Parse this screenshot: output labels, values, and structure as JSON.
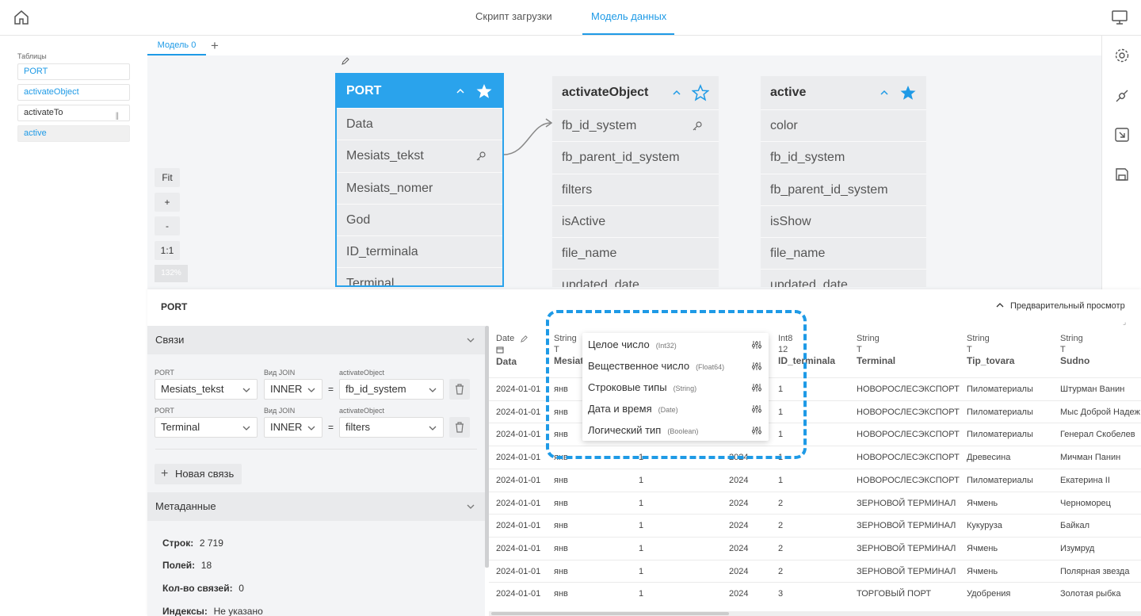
{
  "top_tabs": [
    "Скрипт загрузки",
    "Модель данных"
  ],
  "sidebar": {
    "title": "Таблицы",
    "items": [
      "PORT",
      "activateObject",
      "activateTo",
      "active"
    ]
  },
  "model_tab": "Модель 0",
  "zoom": {
    "fit": "Fit",
    "plus": "+",
    "minus": "-",
    "one": "1:1",
    "pct": "132%"
  },
  "tables": {
    "port": {
      "name": "PORT",
      "fields": [
        "Data",
        "Mesiats_tekst",
        "Mesiats_nomer",
        "God",
        "ID_terminala",
        "Terminal"
      ]
    },
    "activate_object": {
      "name": "activateObject",
      "fields": [
        "fb_id_system",
        "fb_parent_id_system",
        "filters",
        "isActive",
        "file_name",
        "updated_date"
      ]
    },
    "active": {
      "name": "active",
      "fields": [
        "color",
        "fb_id_system",
        "fb_parent_id_system",
        "isShow",
        "file_name",
        "updated_date"
      ]
    }
  },
  "panel": {
    "title": "PORT",
    "preview": "Предварительный просмотр"
  },
  "links": {
    "header": "Связи",
    "rows": [
      {
        "left_label": "PORT",
        "left_value": "Mesiats_tekst",
        "join_label": "Вид JOIN",
        "join_value": "INNER",
        "eq": "=",
        "right_label": "activateObject",
        "right_value": "fb_id_system"
      },
      {
        "left_label": "PORT",
        "left_value": "Terminal",
        "join_label": "Вид JOIN",
        "join_value": "INNER",
        "eq": "=",
        "right_label": "activateObject",
        "right_value": "filters"
      }
    ],
    "new_link": "Новая связь"
  },
  "metadata": {
    "header": "Метаданные",
    "rows": [
      {
        "key": "Строк:",
        "value": "2 719"
      },
      {
        "key": "Полей:",
        "value": "18"
      },
      {
        "key": "Кол-во связей:",
        "value": "0"
      },
      {
        "key": "Индексы:",
        "value": "Не указано"
      }
    ]
  },
  "grid": {
    "columns": [
      {
        "type": "Date",
        "icon": "calendar-icon",
        "name": "Data"
      },
      {
        "type": "String",
        "icon": "T",
        "name": "Mesiats_tekst"
      },
      {
        "type": "",
        "icon": "",
        "name": ""
      },
      {
        "type": "",
        "icon": "",
        "name": ""
      },
      {
        "type": "Int8",
        "icon": "12",
        "name": "ID_terminala"
      },
      {
        "type": "String",
        "icon": "T",
        "name": "Terminal"
      },
      {
        "type": "String",
        "icon": "T",
        "name": "Tip_tovara"
      },
      {
        "type": "String",
        "icon": "T",
        "name": "Sudno"
      }
    ],
    "rows": [
      [
        "2024-01-01",
        "янв",
        "",
        "",
        "1",
        "НОВОРОСЛЕСЭКСПОРТ",
        "Пиломатериалы",
        "Штурман Ванин"
      ],
      [
        "2024-01-01",
        "янв",
        "",
        "",
        "1",
        "НОВОРОСЛЕСЭКСПОРТ",
        "Пиломатериалы",
        "Мыс Доброй Надеж"
      ],
      [
        "2024-01-01",
        "янв",
        "",
        "",
        "1",
        "НОВОРОСЛЕСЭКСПОРТ",
        "Пиломатериалы",
        "Генерал Скобелев"
      ],
      [
        "2024-01-01",
        "янв",
        "1",
        "2024",
        "1",
        "НОВОРОСЛЕСЭКСПОРТ",
        "Древесина",
        "Мичман Панин"
      ],
      [
        "2024-01-01",
        "янв",
        "1",
        "2024",
        "1",
        "НОВОРОСЛЕСЭКСПОРТ",
        "Пиломатериалы",
        "Екатерина II"
      ],
      [
        "2024-01-01",
        "янв",
        "1",
        "2024",
        "2",
        "ЗЕРНОВОЙ ТЕРМИНАЛ",
        "Ячмень",
        "Черноморец"
      ],
      [
        "2024-01-01",
        "янв",
        "1",
        "2024",
        "2",
        "ЗЕРНОВОЙ ТЕРМИНАЛ",
        "Кукуруза",
        "Байкал"
      ],
      [
        "2024-01-01",
        "янв",
        "1",
        "2024",
        "2",
        "ЗЕРНОВОЙ ТЕРМИНАЛ",
        "Ячмень",
        "Изумруд"
      ],
      [
        "2024-01-01",
        "янв",
        "1",
        "2024",
        "2",
        "ЗЕРНОВОЙ ТЕРМИНАЛ",
        "Ячмень",
        "Полярная звезда"
      ],
      [
        "2024-01-01",
        "янв",
        "1",
        "2024",
        "3",
        "ТОРГОВЫЙ ПОРТ",
        "Удобрения",
        "Золотая рыбка"
      ]
    ]
  },
  "type_menu": [
    {
      "label": "Целое число",
      "sub": "(Int32)"
    },
    {
      "label": "Вещественное число",
      "sub": "(Float64)"
    },
    {
      "label": "Строковые типы",
      "sub": "(String)"
    },
    {
      "label": "Дата и время",
      "sub": "(Date)"
    },
    {
      "label": "Логический тип",
      "sub": "(Boolean)"
    }
  ],
  "colors": {
    "accent": "#1e9ae6",
    "highlight": "#2aa3ec"
  }
}
